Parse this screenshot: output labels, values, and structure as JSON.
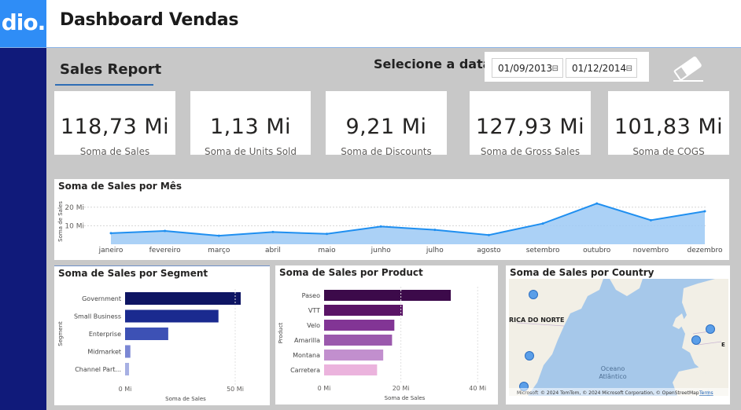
{
  "app": {
    "logo_text": "dio.",
    "title": "Dashboard Vendas"
  },
  "report": {
    "title": "Sales Report",
    "date_label": "Selecione a data"
  },
  "filters": {
    "start_date": "01/09/2013",
    "end_date": "01/12/2014",
    "calendar_icon": "calendar-icon",
    "clear_icon": "eraser-icon"
  },
  "kpis": [
    {
      "value": "118,73 Mi",
      "label": "Soma de  Sales"
    },
    {
      "value": "1,13 Mi",
      "label": "Soma de Units Sold"
    },
    {
      "value": "9,21 Mi",
      "label": "Soma de Discounts"
    },
    {
      "value": "127,93 Mi",
      "label": "Soma de Gross Sales"
    },
    {
      "value": "101,83 Mi",
      "label": "Soma de COGS"
    }
  ],
  "panels": {
    "monthly": "Soma de Sales por Mês",
    "segment": "Soma de Sales por Segment",
    "product": "Soma de Sales por Product",
    "country": "Soma de Sales por Country"
  },
  "map": {
    "labels": {
      "north_america": "RICA DO NORTE",
      "ocean": "Oceano\nAtlântico",
      "ocean_line1": "Oceano",
      "ocean_line2": "Atlântico",
      "europe_marker": "E"
    },
    "attribution": "© 2024 TomTom, © 2024 Microsoft Corporation, © OpenStreetMap",
    "terms": "Terms",
    "brand": "Microsoft",
    "colors": {
      "water": "#a6c8ea",
      "land": "#f2efe6",
      "bubble": "#5a9ee8"
    }
  },
  "chart_data": [
    {
      "type": "area",
      "title": "Soma de Sales por Mês",
      "ylabel": "Soma de Sales",
      "categories": [
        "janeiro",
        "fevereiro",
        "março",
        "abril",
        "maio",
        "junho",
        "julho",
        "agosto",
        "setembro",
        "outubro",
        "novembro",
        "dezembro"
      ],
      "values": [
        6.0,
        7.2,
        4.6,
        6.6,
        5.6,
        9.6,
        7.8,
        5.0,
        11.2,
        22.0,
        13.0,
        17.8
      ],
      "ylim": [
        0,
        25
      ],
      "yticks": [
        10,
        20
      ],
      "ytick_labels": [
        "10 Mi",
        "20 Mi"
      ],
      "color": "#1f8ff0",
      "fill": "#9cc9f5",
      "grid": true
    },
    {
      "type": "bar",
      "orientation": "horizontal",
      "title": "Soma de Sales por Segment",
      "ylabel": "Segment",
      "xlabel": "Soma de Sales",
      "categories": [
        "Government",
        "Small Business",
        "Enterprise",
        "Midmarket",
        "Channel Part..."
      ],
      "values": [
        52.5,
        42.4,
        19.6,
        2.4,
        1.8
      ],
      "colors": [
        "#0e1563",
        "#1a2a8f",
        "#3d51b5",
        "#7b87d4",
        "#a7b0e3"
      ],
      "xlim": [
        0,
        55
      ],
      "xticks": [
        0,
        50
      ],
      "xtick_labels": [
        "0 Mi",
        "50 Mi"
      ]
    },
    {
      "type": "bar",
      "orientation": "horizontal",
      "title": "Soma de Sales por Product",
      "ylabel": "Product",
      "xlabel": "Soma de Sales",
      "categories": [
        "Paseo",
        "VTT",
        "Velo",
        "Amarilla",
        "Montana",
        "Carretera"
      ],
      "values": [
        33.0,
        20.5,
        18.3,
        17.7,
        15.4,
        13.8
      ],
      "colors": [
        "#3c0a4a",
        "#5a1466",
        "#823595",
        "#9b59ad",
        "#c28fce",
        "#ebb3dd"
      ],
      "xlim": [
        0,
        42
      ],
      "xticks": [
        0,
        20,
        40
      ],
      "xtick_labels": [
        "0 Mi",
        "20 Mi",
        "40 Mi"
      ]
    }
  ]
}
